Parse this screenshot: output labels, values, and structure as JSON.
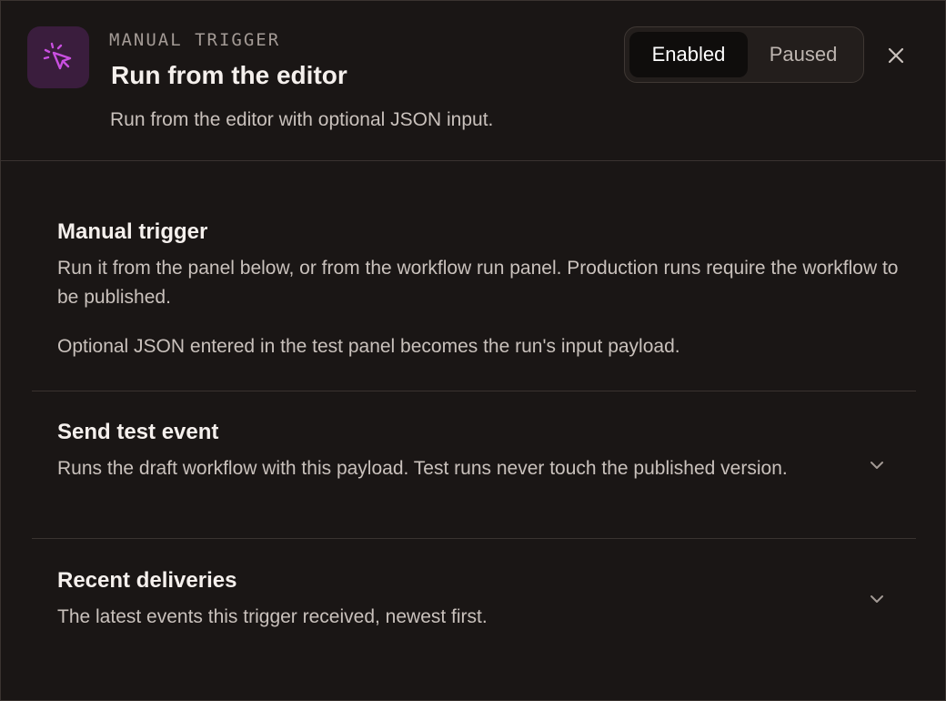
{
  "header": {
    "eyebrow": "MANUAL TRIGGER",
    "title": "Run from the editor",
    "subtitle": "Run from the editor with optional JSON input.",
    "icon": "cursor-click-icon",
    "accent": "#c94fe0",
    "status_toggle": {
      "options": [
        "Enabled",
        "Paused"
      ],
      "selected": "Enabled"
    },
    "close_icon": "close-icon"
  },
  "sections": {
    "manual": {
      "title": "Manual trigger",
      "body1": "Run it from the panel below, or from the workflow run panel. Production runs require the workflow to be published.",
      "body2": "Optional JSON entered in the test panel becomes the run's input payload."
    },
    "test_event": {
      "title": "Send test event",
      "body": "Runs the draft workflow with this payload. Test runs never touch the published version.",
      "expanded": false
    },
    "recent": {
      "title": "Recent deliveries",
      "body": "The latest events this trigger received, newest first.",
      "expanded": false
    }
  }
}
